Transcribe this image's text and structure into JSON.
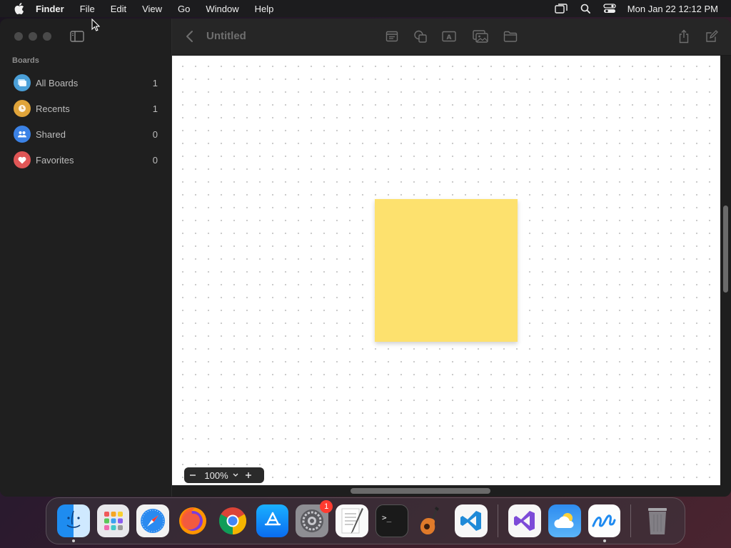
{
  "menubar": {
    "app_name": "Finder",
    "menus": [
      "File",
      "Edit",
      "View",
      "Go",
      "Window",
      "Help"
    ],
    "clock": "Mon Jan 22  12:12 PM",
    "status_icons": [
      "screen-mirroring-icon",
      "search-icon",
      "control-center-icon"
    ]
  },
  "sidebar": {
    "heading": "Boards",
    "items": [
      {
        "label": "All Boards",
        "count": "1",
        "icon": "all-boards-icon",
        "color": "#4a9fd8"
      },
      {
        "label": "Recents",
        "count": "1",
        "icon": "clock-icon",
        "color": "#e0a43a"
      },
      {
        "label": "Shared",
        "count": "0",
        "icon": "people-icon",
        "color": "#3b82e6"
      },
      {
        "label": "Favorites",
        "count": "0",
        "icon": "heart-icon",
        "color": "#e05656"
      }
    ]
  },
  "toolbar": {
    "title": "Untitled",
    "tools": [
      "sticky-note-icon",
      "shapes-icon",
      "text-box-icon",
      "media-icon",
      "folder-icon"
    ],
    "actions": [
      "share-icon",
      "new-board-icon"
    ]
  },
  "canvas": {
    "sticky_color": "#fde16e"
  },
  "zoom": {
    "value": "100%"
  },
  "dock": {
    "apps": [
      "Finder",
      "Launchpad",
      "Safari",
      "Firefox",
      "Chrome",
      "App Store",
      "System Settings",
      "TextEdit",
      "Terminal",
      "GarageBand",
      "Visual Studio Code",
      "Visual Studio",
      "Weather",
      "Freeform",
      "Trash"
    ],
    "badge_system_settings": "1"
  }
}
